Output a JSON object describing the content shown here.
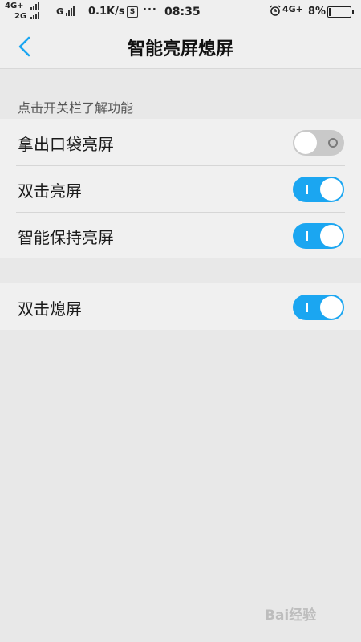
{
  "status_bar": {
    "net_top": "4G+",
    "net_bottom": "2G",
    "net_mid": "G",
    "speed": "0.1K/s",
    "sim_label": "S",
    "dots": "···",
    "time": "08:35",
    "net_right": "4G+",
    "battery_pct": "8%",
    "battery_level": 0.08
  },
  "header": {
    "title": "智能亮屏熄屏"
  },
  "hint": "点击开关栏了解功能",
  "groups": [
    {
      "rows": [
        {
          "label": "拿出口袋亮屏",
          "enabled": false
        },
        {
          "label": "双击亮屏",
          "enabled": true
        },
        {
          "label": "智能保持亮屏",
          "enabled": true
        }
      ]
    },
    {
      "rows": [
        {
          "label": "双击熄屏",
          "enabled": true
        }
      ]
    }
  ],
  "colors": {
    "accent": "#1ba6f1",
    "toggle_off": "#c9c9c9",
    "background": "#e8e8e8"
  },
  "watermark": "Bai经验"
}
